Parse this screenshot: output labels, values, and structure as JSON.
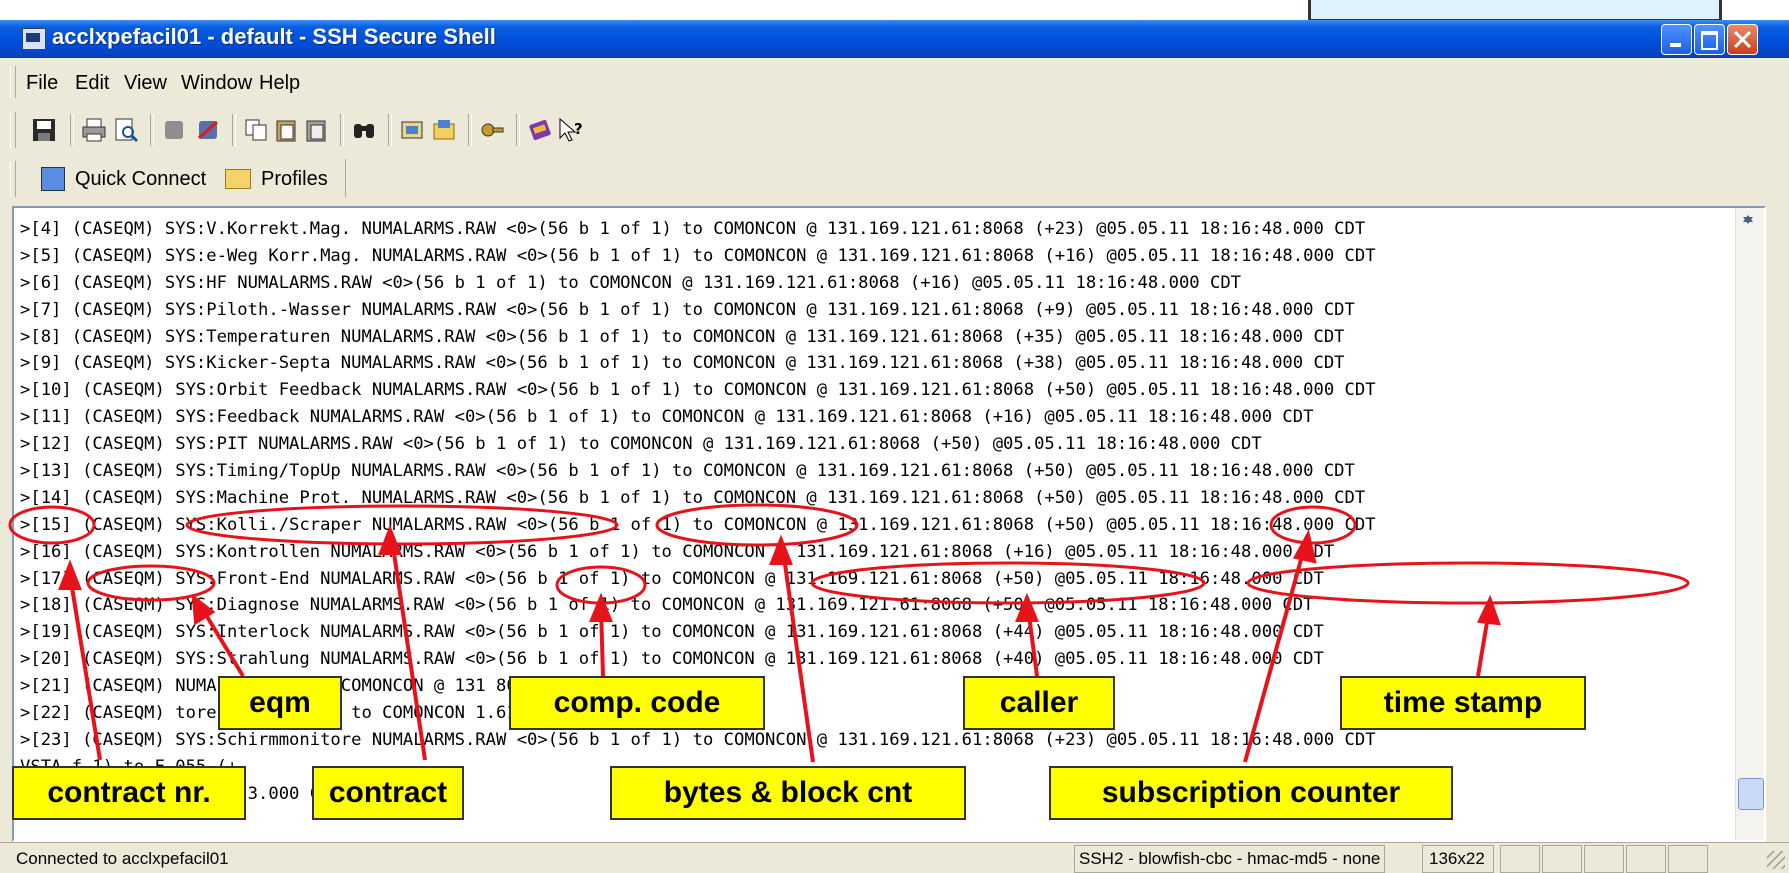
{
  "window": {
    "title": "acclxpefacil01 - default - SSH Secure Shell",
    "controls": [
      "minimize",
      "maximize",
      "close"
    ]
  },
  "menu": {
    "items": [
      "File",
      "Edit",
      "View",
      "Window",
      "Help"
    ]
  },
  "toolbar": {
    "icons": [
      "save-icon",
      "print-icon",
      "print-preview-icon",
      "disconnect-icon",
      "connect-icon",
      "copy-icon",
      "paste-icon",
      "paste-special-icon",
      "find-icon",
      "settings-icon",
      "profiles-icon",
      "keys-icon",
      "help-icon",
      "context-help-icon"
    ]
  },
  "quickbar": {
    "quick_connect": "Quick Connect",
    "profiles": "Profiles"
  },
  "terminal": {
    "lines": [
      ">[4] (CASEQM) SYS:V.Korrekt.Mag. NUMALARMS.RAW <0>(56 b 1 of 1) to COMONCON @ 131.169.121.61:8068 (+23) @05.05.11 18:16:48.000 CDT",
      ">[5] (CASEQM) SYS:e-Weg Korr.Mag. NUMALARMS.RAW <0>(56 b 1 of 1) to COMONCON @ 131.169.121.61:8068 (+16) @05.05.11 18:16:48.000 CDT",
      ">[6] (CASEQM) SYS:HF NUMALARMS.RAW <0>(56 b 1 of 1) to COMONCON @ 131.169.121.61:8068 (+16) @05.05.11 18:16:48.000 CDT",
      ">[7] (CASEQM) SYS:Piloth.-Wasser NUMALARMS.RAW <0>(56 b 1 of 1) to COMONCON @ 131.169.121.61:8068 (+9) @05.05.11 18:16:48.000 CDT",
      ">[8] (CASEQM) SYS:Temperaturen NUMALARMS.RAW <0>(56 b 1 of 1) to COMONCON @ 131.169.121.61:8068 (+35) @05.05.11 18:16:48.000 CDT",
      ">[9] (CASEQM) SYS:Kicker-Septa NUMALARMS.RAW <0>(56 b 1 of 1) to COMONCON @ 131.169.121.61:8068 (+38) @05.05.11 18:16:48.000 CDT",
      ">[10] (CASEQM) SYS:Orbit Feedback NUMALARMS.RAW <0>(56 b 1 of 1) to COMONCON @ 131.169.121.61:8068 (+50) @05.05.11 18:16:48.000 CDT",
      ">[11] (CASEQM) SYS:Feedback NUMALARMS.RAW <0>(56 b 1 of 1) to COMONCON @ 131.169.121.61:8068 (+16) @05.05.11 18:16:48.000 CDT",
      ">[12] (CASEQM) SYS:PIT NUMALARMS.RAW <0>(56 b 1 of 1) to COMONCON @ 131.169.121.61:8068 (+50) @05.05.11 18:16:48.000 CDT",
      ">[13] (CASEQM) SYS:Timing/TopUp NUMALARMS.RAW <0>(56 b 1 of 1) to COMONCON @ 131.169.121.61:8068 (+50) @05.05.11 18:16:48.000 CDT",
      ">[14] (CASEQM) SYS:Machine Prot. NUMALARMS.RAW <0>(56 b 1 of 1) to COMONCON @ 131.169.121.61:8068 (+50) @05.05.11 18:16:48.000 CDT",
      ">[15] (CASEQM) SYS:Kolli./Scraper NUMALARMS.RAW <0>(56 b 1 of 1) to COMONCON @ 131.169.121.61:8068 (+50) @05.05.11 18:16:48.000 CDT",
      ">[16] (CASEQM) SYS:Kontrollen NUMALARMS.RAW <0>(56 b 1 of 1) to COMONCON @ 131.169.121.61:8068 (+16) @05.05.11 18:16:48.000 CDT",
      ">[17] (CASEQM) SYS:Front-End NUMALARMS.RAW <0>(56 b 1 of 1) to COMONCON @ 131.169.121.61:8068 (+50) @05.05.11 18:16:48.000 CDT",
      ">[18] (CASEQM) SYS:Diagnose NUMALARMS.RAW <0>(56 b 1 of 1) to COMONCON @ 131.169.121.61:8068 (+50) @05.05.11 18:16:48.000 CDT",
      ">[19] (CASEQM) SYS:Interlock NUMALARMS.RAW <0>(56 b 1 of 1) to COMONCON @ 131.169.121.61:8068 (+44) @05.05.11 18:16:48.000 CDT",
      ">[20] (CASEQM) SYS:Strahlung NUMALARMS.RAW <0>(56 b 1 of 1) to COMONCON @ 131.169.121.61:8068 (+40) @05.05.11 18:16:48.000 CDT",
      ">[21] (CASEQM) NUMALARMS.RA to COMONCON @ 131 8068 (+34) @05.05.",
      ">[22] (CASEQM) toren NUMALAR 1) to COMONCON 1.61:8068 (+34) @0 0 CDT",
      ">[23] (CASEQM) SYS:Schirmmonitore NUMALARMS.RAW <0>(56 b 1 of 1) to COMONCON @ 131.169.121.61:8068 (+23) @05.05.11 18:16:48.000 CDT",
      "VSTA f 1) to F 055 (+",
      "gerM RMS <0>(4 .169.5 3.000 CDT"
    ]
  },
  "statusbar": {
    "text": "Connected to acclxpefacil01",
    "connection": "SSH2 - blowfish-cbc - hmac-md5 - none",
    "terminal_size": "136x22"
  },
  "annotations": {
    "eqm": "eqm",
    "comp_code": "comp. code",
    "caller": "caller",
    "time_stamp": "time stamp",
    "contract_nr": "contract nr.",
    "contract": "contract",
    "bytes_block": "bytes & block cnt",
    "subscription_counter": "subscription counter",
    "color": "#e8121b",
    "label_bg": "#ffff00"
  }
}
